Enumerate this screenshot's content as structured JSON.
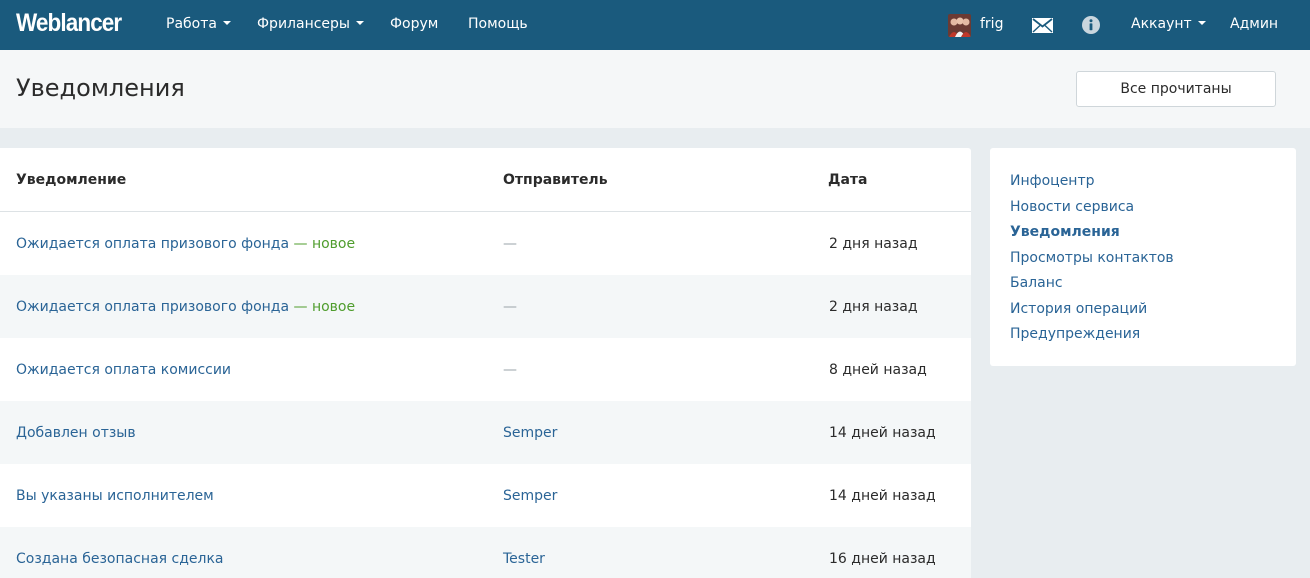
{
  "navbar": {
    "logo": "Weblancer",
    "menu": [
      {
        "label": "Работа",
        "dropdown": true
      },
      {
        "label": "Фрилансеры",
        "dropdown": true
      },
      {
        "label": "Форум",
        "dropdown": false
      },
      {
        "label": "Помощь",
        "dropdown": false
      }
    ],
    "username": "frig",
    "account_label": "Аккаунт",
    "admin_label": "Админ",
    "icons": [
      "avatar",
      "mail-icon",
      "info-icon"
    ]
  },
  "page_header": {
    "title": "Уведомления",
    "mark_all_read_label": "Все прочитаны"
  },
  "table": {
    "columns": [
      "Уведомление",
      "Отправитель",
      "Дата"
    ],
    "new_label": "— новое",
    "rows": [
      {
        "notification": "Ожидается оплата призового фонда",
        "is_new": true,
        "sender": "—",
        "date": "2 дня назад"
      },
      {
        "notification": "Ожидается оплата призового фонда",
        "is_new": true,
        "sender": "—",
        "date": "2 дня назад"
      },
      {
        "notification": "Ожидается оплата комиссии",
        "is_new": false,
        "sender": "—",
        "date": "8 дней назад"
      },
      {
        "notification": "Добавлен отзыв",
        "is_new": false,
        "sender": "Semper",
        "date": "14 дней назад"
      },
      {
        "notification": "Вы указаны исполнителем",
        "is_new": false,
        "sender": "Semper",
        "date": "14 дней назад"
      },
      {
        "notification": "Создана безопасная сделка",
        "is_new": false,
        "sender": "Tester",
        "date": "16 дней назад"
      }
    ]
  },
  "sidebar": {
    "items": [
      {
        "label": "Инфоцентр",
        "active": false
      },
      {
        "label": "Новости сервиса",
        "active": false
      },
      {
        "label": "Уведомления",
        "active": true
      },
      {
        "label": "Просмотры контактов",
        "active": false
      },
      {
        "label": "Баланс",
        "active": false
      },
      {
        "label": "История операций",
        "active": false
      },
      {
        "label": "Предупреждения",
        "active": false
      }
    ]
  },
  "colors": {
    "navbar_bg": "#1a5a7d",
    "link": "#2a6496",
    "new_badge": "#4f9d2d",
    "page_bg": "#e8edf0"
  }
}
